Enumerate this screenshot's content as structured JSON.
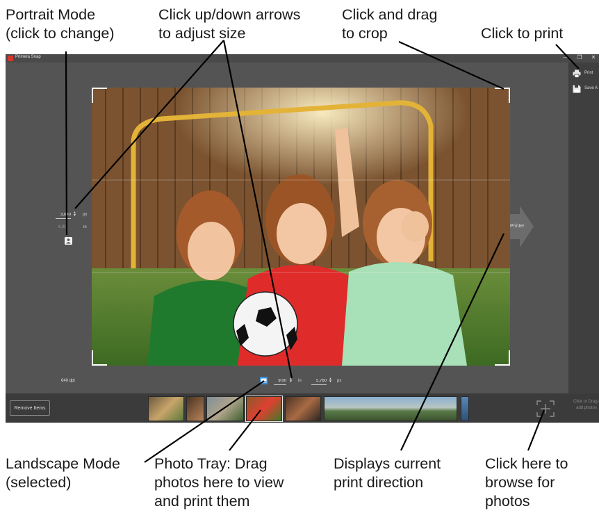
{
  "callouts": {
    "portrait_mode": [
      "Portrait Mode",
      "(click to change)"
    ],
    "arrows": [
      "Click up/down arrows",
      "to adjust size"
    ],
    "crop": [
      "Click and drag",
      "to crop"
    ],
    "print": [
      "Click to print"
    ],
    "landscape_mode": [
      "Landscape Mode",
      "(selected)"
    ],
    "photo_tray": [
      "Photo Tray: Drag",
      "photos here to view",
      "and print them"
    ],
    "print_direction": [
      "Displays current",
      "print direction"
    ],
    "browse": [
      "Click here to",
      "browse for",
      "photos"
    ]
  },
  "app": {
    "title": "Primera Snap",
    "window_controls": [
      "—",
      "❐",
      "✕"
    ]
  },
  "sidebar": {
    "print_label": "Print",
    "save_label": "Save A"
  },
  "left_size": {
    "value": "3,840",
    "unit_px": "px",
    "value_in": "6.00",
    "unit_in": "in"
  },
  "bottom_size": {
    "inches": "9.00",
    "unit_in": "in",
    "pixels": "5,760",
    "unit_px": "px"
  },
  "dpi": "640 dpi",
  "printer_label": "Printer",
  "tray": {
    "remove_label": "Remove Items",
    "add_text": [
      "Click or Drag t",
      "add photos"
    ]
  },
  "icons": {
    "portrait": "portrait-icon",
    "landscape": "landscape-icon",
    "print": "printer-icon",
    "save": "save-icon",
    "add": "add-photo-icon",
    "arrow": "print-direction-arrow"
  },
  "colors": {
    "app_bg": "#545454",
    "sidebar_bg": "#3f3f3f",
    "tray_bg": "#3b3b3b",
    "landscape_selected": "#3f8fd6",
    "logo_red": "#d8352c"
  }
}
